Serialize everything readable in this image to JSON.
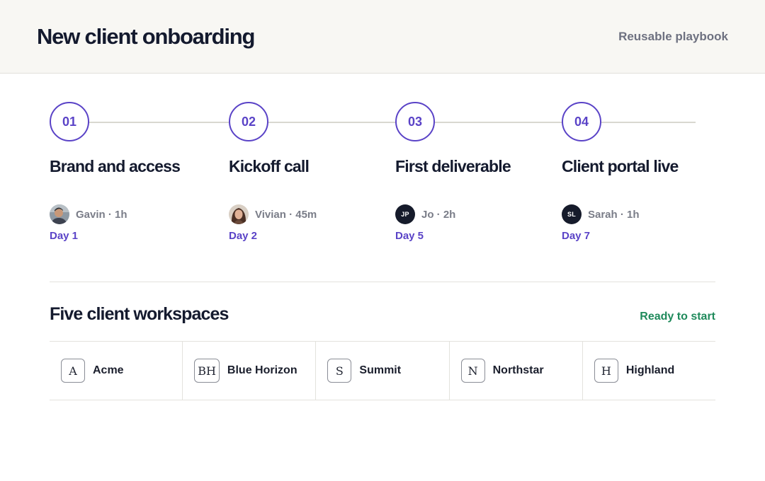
{
  "header": {
    "title": "New client onboarding",
    "link": "Reusable playbook"
  },
  "steps": [
    {
      "number": "01",
      "title": "Brand and access",
      "owner": "Gavin · 1h",
      "avatar_icon": "gavin-avatar-photo",
      "day": "Day 1"
    },
    {
      "number": "02",
      "title": "Kickoff call",
      "owner": "Vivian · 45m",
      "avatar_icon": "vivian-avatar-photo",
      "day": "Day 2"
    },
    {
      "number": "03",
      "title": "First deliverable",
      "owner": "Jo · 2h",
      "avatar_initials": "JP",
      "day": "Day 5"
    },
    {
      "number": "04",
      "title": "Client portal live",
      "owner": "Sarah · 1h",
      "avatar_initials": "SL",
      "day": "Day 7"
    }
  ],
  "workspaces_section": {
    "title": "Five client workspaces",
    "status": "Ready to start",
    "items": [
      {
        "mark": "A",
        "name": "Acme"
      },
      {
        "mark": "BH",
        "name": "Blue Horizon"
      },
      {
        "mark": "S",
        "name": "Summit"
      },
      {
        "mark": "N",
        "name": "Northstar"
      },
      {
        "mark": "H",
        "name": "Highland"
      }
    ]
  },
  "colors": {
    "accent": "#5a43c7",
    "ready": "#1f8a5b",
    "header_bg": "#f8f7f3",
    "text": "#141a2e"
  }
}
